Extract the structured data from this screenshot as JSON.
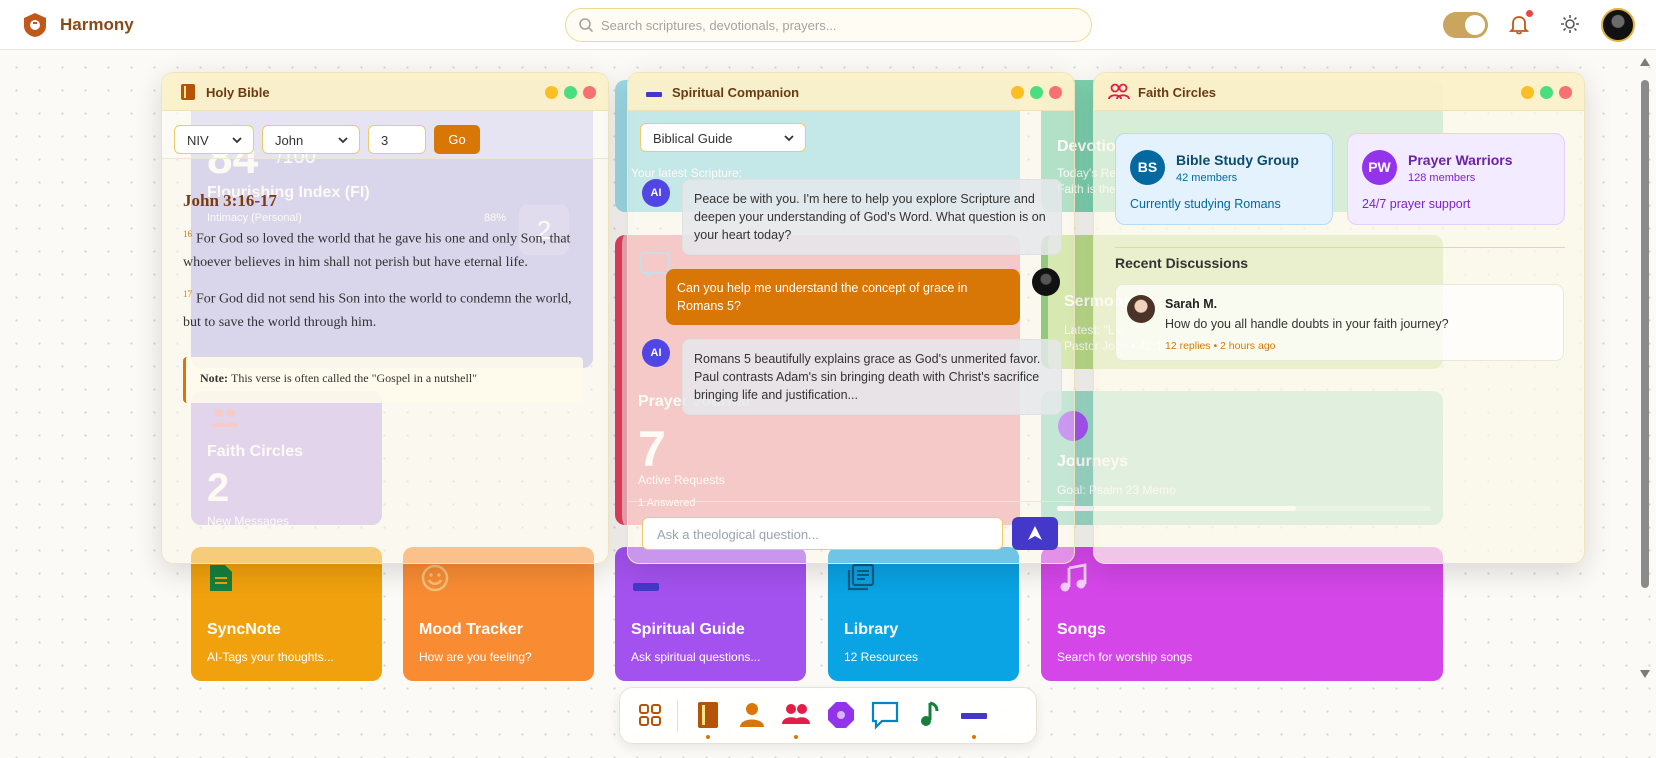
{
  "header": {
    "brand": "Harmony",
    "search_placeholder": "Search scriptures, devotionals, prayers..."
  },
  "background_tiles": {
    "flourishing": {
      "score": "84",
      "score_suffix": "/100",
      "title": "Flourishing Index (FI)",
      "metric_label": "Intimacy (Personal)",
      "metric_value": "88%",
      "badge": "2"
    },
    "faith_circles": {
      "title": "Faith Circles",
      "count": "2",
      "sub": "New Messages"
    },
    "verse": {
      "label": "Your latest Scripture:"
    },
    "devotional": {
      "title": "Devotio",
      "line1": "Today's Re",
      "line2": "Faith is the"
    },
    "prayer": {
      "title": "Prayer Journal",
      "count": "7",
      "label": "Active Requests",
      "sub": "1 Answered"
    },
    "sermons": {
      "title": "Sermons",
      "line1": "Latest: \"Liv",
      "line2": "Pastor John • 42:18"
    },
    "journeys": {
      "title": "Journeys",
      "goal": "Goal: Psalm 23 Memo",
      "progress": 0.64
    },
    "syncnote": {
      "title": "SyncNote",
      "sub": "AI-Tags your thoughts..."
    },
    "mood": {
      "title": "Mood Tracker",
      "sub": "How are you feeling?"
    },
    "guide": {
      "title": "Spiritual Guide",
      "sub": "Ask spiritual questions..."
    },
    "library": {
      "title": "Library",
      "sub": "12 Resources"
    },
    "songs": {
      "title": "Songs",
      "sub": "Search for worship songs"
    }
  },
  "bible_window": {
    "title": "Holy Bible",
    "translation": "NIV",
    "book": "John",
    "chapter": "3",
    "go_label": "Go",
    "reference": "John 3:16-17",
    "verses": [
      {
        "num": "16",
        "text": "For God so loved the world that he gave his one and only Son, that whoever believes in him shall not perish but have eternal life."
      },
      {
        "num": "17",
        "text": "For God did not send his Son into the world to condemn the world, but to save the world through him."
      }
    ],
    "note_label": "Note:",
    "note_text": "This verse is often called the \"Gospel in a nutshell\""
  },
  "companion_window": {
    "title": "Spiritual Companion",
    "mode": "Biblical Guide",
    "ai_badge": "AI",
    "messages": [
      {
        "role": "ai",
        "text": "Peace be with you. I'm here to help you explore Scripture and deepen your understanding of God's Word. What question is on your heart today?"
      },
      {
        "role": "user",
        "text": "Can you help me understand the concept of grace in Romans 5?"
      },
      {
        "role": "ai",
        "text": "Romans 5 beautifully explains grace as God's unmerited favor. Paul contrasts Adam's sin bringing death with Christ's sacrifice bringing life and justification..."
      }
    ],
    "input_placeholder": "Ask a theological question..."
  },
  "faith_window": {
    "title": "Faith Circles",
    "groups": [
      {
        "initials": "BS",
        "name": "Bible Study Group",
        "members": "42 members",
        "desc": "Currently studying Romans",
        "color": "#0369a1",
        "bg": "#e0f2fe"
      },
      {
        "initials": "PW",
        "name": "Prayer Warriors",
        "members": "128 members",
        "desc": "24/7 prayer support",
        "color": "#7e22ce",
        "bg": "#f3e8ff"
      }
    ],
    "recent_heading": "Recent Discussions",
    "discussion": {
      "author": "Sarah M.",
      "text": "How do you all handle doubts in your faith journey?",
      "meta": "12 replies • 2 hours ago"
    }
  },
  "dock": [
    "apps-grid-icon",
    "bible-icon",
    "person-icon",
    "people-icon",
    "journey-icon",
    "chat-icon",
    "music-note-icon",
    "guide-icon"
  ]
}
